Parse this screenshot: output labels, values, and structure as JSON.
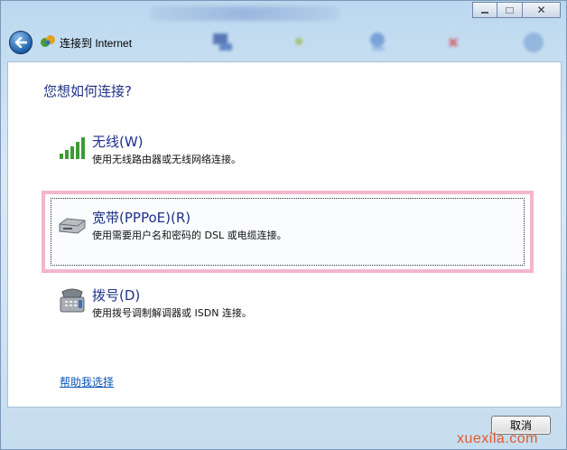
{
  "window": {
    "header_title": "连接到 Internet",
    "close_glyph": "✕"
  },
  "main": {
    "question": "您想如何连接?",
    "options": [
      {
        "title": "无线(W)",
        "desc": "使用无线路由器或无线网络连接。",
        "icon": "wireless-signal-icon"
      },
      {
        "title": "宽带(PPPoE)(R)",
        "desc": "使用需要用户名和密码的 DSL 或电缆连接。",
        "icon": "broadband-modem-icon"
      },
      {
        "title": "拨号(D)",
        "desc": "使用拨号调制解调器或 ISDN 连接。",
        "icon": "dialup-phone-icon"
      }
    ],
    "help_link": "帮助我选择"
  },
  "footer": {
    "cancel_label": "取消"
  },
  "watermark": "xuexila.com",
  "colors": {
    "accent_text": "#1e3287",
    "link": "#0a56b5",
    "highlight_border": "#f2b6cf",
    "watermark": "#e05a2a"
  }
}
